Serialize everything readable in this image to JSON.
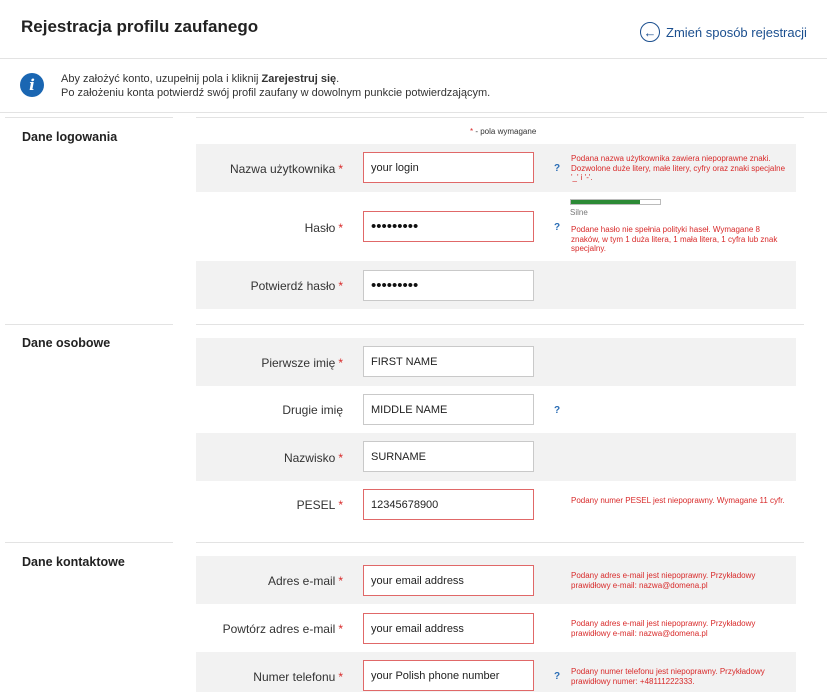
{
  "header": {
    "title": "Rejestracja profilu zaufanego",
    "change_method": "Zmień sposób rejestracji"
  },
  "info": {
    "line1_prefix": "Aby założyć konto, uzupełnij pola i kliknij ",
    "line1_bold": "Zarejestruj się",
    "line1_suffix": ".",
    "line2": "Po założeniu konta potwierdź swój profil zaufany w dowolnym punkcie potwierdzającym."
  },
  "required_note": {
    "star": "*",
    "text": " - pola wymagane"
  },
  "sections": {
    "login": "Dane logowania",
    "personal": "Dane osobowe",
    "contact": "Dane kontaktowe"
  },
  "fields": {
    "username": {
      "label": "Nazwa użytkownika",
      "star": "*",
      "value": "your login",
      "help": "?",
      "error": "Podana nazwa użytkownika zawiera niepoprawne znaki. Dozwolone duże litery, małe litery, cyfry oraz znaki specjalne '_' i '-'."
    },
    "password": {
      "label": "Hasło",
      "star": "*",
      "value": "•••••••••",
      "help": "?",
      "strength_label": "Silne",
      "strength_level": 0.78,
      "error": "Podane hasło nie spełnia polityki haseł. Wymagane 8 znaków, w tym 1 duża litera, 1 mała litera, 1 cyfra lub znak specjalny."
    },
    "password_confirm": {
      "label": "Potwierdź hasło",
      "star": "*",
      "value": "•••••••••"
    },
    "first_name": {
      "label": "Pierwsze imię",
      "star": "*",
      "value": "FIRST NAME"
    },
    "middle_name": {
      "label": "Drugie imię",
      "value": "MIDDLE NAME",
      "help": "?"
    },
    "surname": {
      "label": "Nazwisko",
      "star": "*",
      "value": "SURNAME"
    },
    "pesel": {
      "label": "PESEL",
      "star": "*",
      "value": "12345678900",
      "error": "Podany numer PESEL jest niepoprawny. Wymagane 11 cyfr."
    },
    "email": {
      "label": "Adres e-mail",
      "star": "*",
      "value": "your email address",
      "error": "Podany adres e-mail jest niepoprawny. Przykładowy prawidłowy e-mail: nazwa@domena.pl"
    },
    "email_confirm": {
      "label": "Powtórz adres e-mail",
      "star": "*",
      "value": "your email address",
      "error": "Podany adres e-mail jest niepoprawny. Przykładowy prawidłowy e-mail: nazwa@domena.pl"
    },
    "phone": {
      "label": "Numer telefonu",
      "star": "*",
      "value": "your Polish phone number",
      "help": "?",
      "error": "Podany numer telefonu jest niepoprawny. Przykładowy prawidłowy numer: +48111222333."
    }
  },
  "colors": {
    "error": "#d82a2a",
    "accent": "#1b4f8f",
    "strength_fill": "#2c8a36"
  }
}
